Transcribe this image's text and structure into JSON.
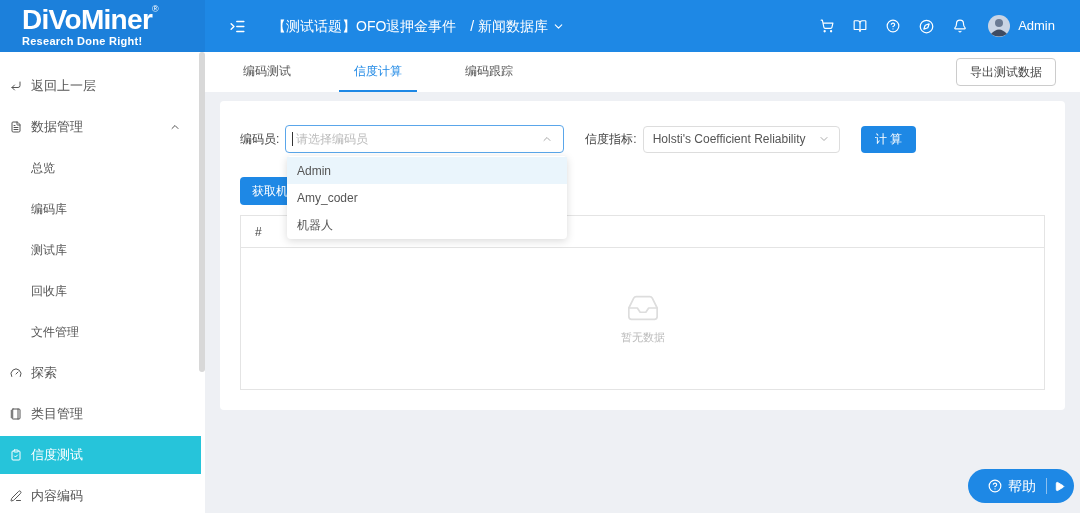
{
  "logo": {
    "name": "DiVoMiner",
    "mark": "®",
    "tagline": "Research Done Right!"
  },
  "breadcrumb": {
    "project": "【测试话题】OFO退押金事件",
    "database": "/ 新闻数据库"
  },
  "user": {
    "name": "Admin"
  },
  "sidebar": {
    "items": [
      {
        "label": "返回上一层",
        "selected": false
      },
      {
        "label": "数据管理",
        "selected": false,
        "expanded": true,
        "children": [
          {
            "label": "总览",
            "selected": false
          },
          {
            "label": "编码库",
            "selected": false
          },
          {
            "label": "测试库",
            "selected": false
          },
          {
            "label": "回收库",
            "selected": false
          },
          {
            "label": "文件管理",
            "selected": false
          }
        ]
      },
      {
        "label": "探索",
        "selected": false
      },
      {
        "label": "类目管理",
        "selected": false
      },
      {
        "label": "信度测试",
        "selected": true
      },
      {
        "label": "内容编码",
        "selected": false
      }
    ]
  },
  "tabs": [
    {
      "label": "编码测试",
      "selected": false
    },
    {
      "label": "信度计算",
      "selected": true
    },
    {
      "label": "编码跟踪",
      "selected": false
    }
  ],
  "export_button": "导出测试数据",
  "form": {
    "coder_label": "编码员:",
    "coder_placeholder": "请选择编码员",
    "metric_label": "信度指标:",
    "metric_value": "Holsti's Coefficient Reliability",
    "compute_button": "计 算"
  },
  "coder_dropdown": {
    "options": [
      {
        "label": "Admin",
        "selected": true
      },
      {
        "label": "Amy_coder",
        "selected": false
      },
      {
        "label": "机器人",
        "selected": false
      }
    ]
  },
  "fetch_button": "获取机",
  "table": {
    "columns": [
      "#"
    ],
    "empty_text": "暂无数据"
  },
  "help_button": "帮助"
}
